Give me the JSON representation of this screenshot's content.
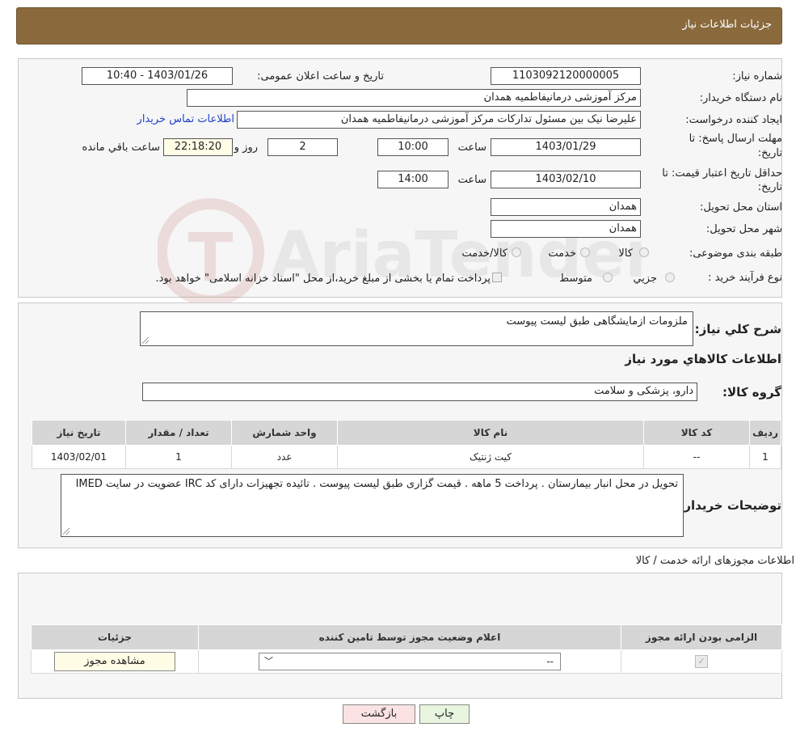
{
  "header": {
    "title": "جزئیات اطلاعات نیاز"
  },
  "fields": {
    "need_number_label": "شماره نیاز:",
    "need_number": "1103092120000005",
    "announce_label": "تاریخ و ساعت اعلان عمومی:",
    "announce_value": "1403/01/26 - 10:40",
    "buyer_org_label": "نام دستگاه خریدار:",
    "buyer_org": "مرکز آموزشی درمانیفاطمیه همدان",
    "requester_label": "ایجاد کننده درخواست:",
    "requester": "علیرضا نیک بین مسئول تدارکات مرکز آموزشی درمانیفاطمیه همدان",
    "contact_link": "اطلاعات تماس خریدار",
    "deadline_label_1": "مهلت ارسال پاسخ: تا",
    "deadline_label_2": "تاریخ:",
    "deadline_date": "1403/01/29",
    "time_label": "ساعت",
    "deadline_time": "10:00",
    "days_value": "2",
    "days_label": "روز و",
    "remaining_time": "22:18:20",
    "remaining_label": "ساعت باقي مانده",
    "validity_label_1": "حداقل تاریخ اعتبار قیمت: تا",
    "validity_label_2": "تاریخ:",
    "validity_date": "1403/02/10",
    "validity_time": "14:00",
    "province_label": "استان محل تحویل:",
    "province": "همدان",
    "city_label": "شهر محل تحویل:",
    "city": "همدان",
    "category_label": "طبقه بندی موضوعی:",
    "category_options": [
      "کالا",
      "خدمت",
      "کالا/خدمت"
    ],
    "process_label": "نوع فرآیند خرید :",
    "process_options": [
      "جزیي",
      "متوسط"
    ],
    "process_note": "پرداخت تمام یا بخشی از مبلغ خرید،از محل \"اسناد خزانه اسلامی\" خواهد بود."
  },
  "summary": {
    "desc_label": "شرح کلي نياز:",
    "desc_value": "ملزومات ازمایشگاهی طبق لیست پیوست",
    "goods_info_title": "اطلاعات کالاهاي مورد نياز",
    "goods_group_label": "گروه کالا:",
    "goods_group_value": "دارو، پزشکی و سلامت"
  },
  "goods_table": {
    "headers": [
      "رديف",
      "کد کالا",
      "نام کالا",
      "واحد شمارش",
      "تعداد / مقدار",
      "تاریخ نیاز"
    ],
    "rows": [
      [
        "1",
        "--",
        "کیت ژنتیک",
        "عدد",
        "1",
        "1403/02/01"
      ]
    ]
  },
  "buyer_notes": {
    "label": "توضیحات خریدار:",
    "value": "تحویل در محل انبار بیمارستان . پرداخت 5 ماهه . قیمت گزاری طبق لیست پیوست . تائیده تجهیزات دارای کد IRC عضویت در سایت IMED"
  },
  "permits": {
    "title": "اطلاعات مجوزهای ارائه خدمت / کالا",
    "headers": [
      "الزامی بودن ارائه مجوز",
      "اعلام وضعیت مجوز توسط تامین کننده",
      "جزئیات"
    ],
    "select_value": "--",
    "view_button": "مشاهده مجوز"
  },
  "buttons": {
    "print": "چاپ",
    "back": "بازگشت"
  },
  "watermark_text": "AriaTender.neT",
  "colors": {
    "header_bg": "#8a6a3d",
    "link": "#1e3fc8",
    "print_bg": "#e8f5df",
    "back_bg": "#fbe3e3"
  }
}
